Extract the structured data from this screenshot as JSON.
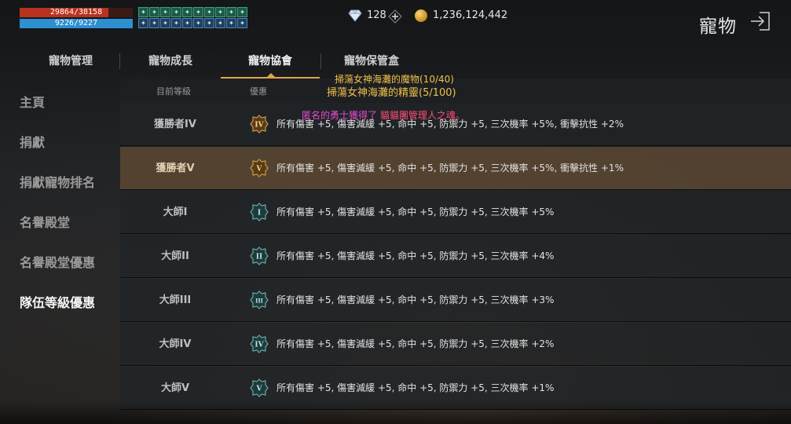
{
  "player": {
    "hp_text": "29864/38158",
    "hp_ratio": 0.783,
    "mp_text": "9226/9227",
    "mp_ratio": 0.9999,
    "buff_icons": [
      "buff-icon",
      "buff-icon",
      "buff-icon",
      "buff-icon",
      "buff-icon",
      "buff-icon",
      "buff-icon",
      "buff-icon",
      "buff-icon",
      "buff-icon",
      "buff-icon",
      "buff-icon",
      "buff-icon",
      "buff-icon",
      "buff-icon",
      "buff-icon",
      "buff-icon",
      "buff-icon",
      "buff-icon",
      "buff-icon"
    ]
  },
  "currency": {
    "gems": "128",
    "gold": "1,236,124,442"
  },
  "header": {
    "title": "寵物"
  },
  "tabs": [
    {
      "label": "寵物管理"
    },
    {
      "label": "寵物成長"
    },
    {
      "label": "寵物協會",
      "active": true
    },
    {
      "label": "寵物保管盒"
    }
  ],
  "sidebar": {
    "items": [
      {
        "label": "主頁"
      },
      {
        "label": "捐獻"
      },
      {
        "label": "捐獻寵物排名"
      },
      {
        "label": "名譽殿堂"
      },
      {
        "label": "名譽殿堂優惠"
      },
      {
        "label": "隊伍等級優惠",
        "active": true
      }
    ]
  },
  "table": {
    "headers": [
      "目前等級",
      "優惠"
    ],
    "rows": [
      {
        "rank": "獲勝者IV",
        "badge": "IV",
        "benefit": "所有傷害 +5, 傷害減緩 +5, 命中 +5, 防禦力 +5, 三次機率 +5%, 衝擊抗性 +2%"
      },
      {
        "rank": "獲勝者V",
        "badge": "V",
        "benefit": "所有傷害 +5, 傷害減緩 +5, 命中 +5, 防禦力 +5, 三次機率 +5%, 衝擊抗性 +1%",
        "highlight": true
      },
      {
        "rank": "大師I",
        "badge": "I",
        "benefit": "所有傷害 +5, 傷害減緩 +5, 命中 +5, 防禦力 +5, 三次機率 +5%"
      },
      {
        "rank": "大師II",
        "badge": "II",
        "benefit": "所有傷害 +5, 傷害減緩 +5, 命中 +5, 防禦力 +5, 三次機率 +4%"
      },
      {
        "rank": "大師III",
        "badge": "III",
        "benefit": "所有傷害 +5, 傷害減緩 +5, 命中 +5, 防禦力 +5, 三次機率 +3%"
      },
      {
        "rank": "大師IV",
        "badge": "IV",
        "benefit": "所有傷害 +5, 傷害減緩 +5, 命中 +5, 防禦力 +5, 三次機率 +2%"
      },
      {
        "rank": "大師V",
        "badge": "V",
        "benefit": "所有傷害 +5, 傷害減緩 +5, 命中 +5, 防禦力 +5, 三次機率 +1%"
      }
    ]
  },
  "quests": {
    "line1": "掃蕩女神海灘的魔物(10/40)",
    "line2": "掃蕩女神海灘的精靈(5/100)"
  },
  "notice": {
    "prefix": "匿名的勇士獲得了",
    "item": "貓貓團管理人之魂。"
  },
  "colors": {
    "accent": "#e0a346",
    "highlight_row": "#5c4832",
    "quest_text": "#f1c24b",
    "notice_text": "#e64bd3",
    "hp": "#b8321f",
    "mp": "#2c8fd0"
  }
}
